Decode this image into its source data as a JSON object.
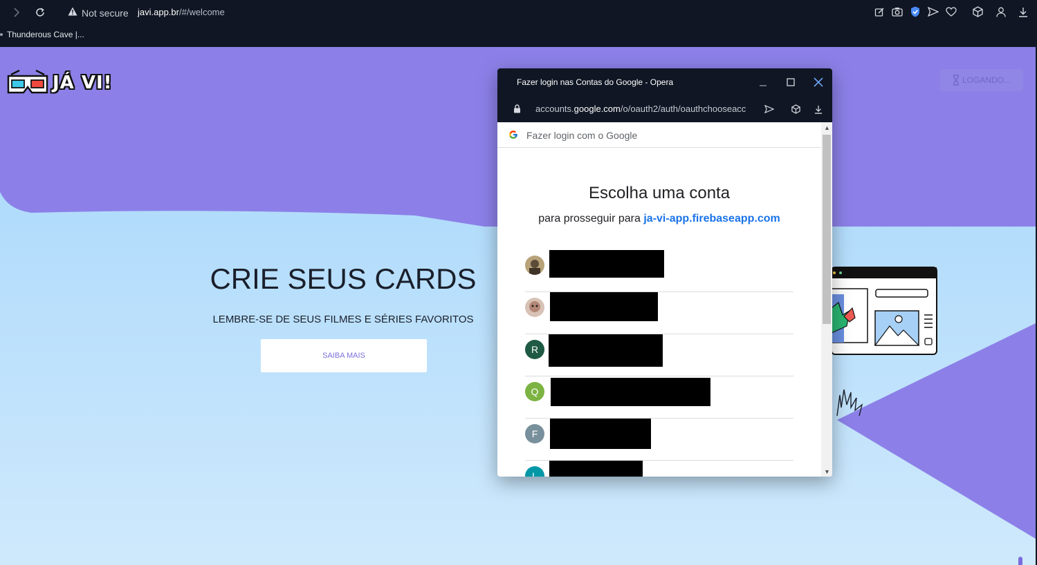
{
  "browser": {
    "security_label": "Not secure",
    "url_host": "javi.app.br",
    "url_path": "/#/welcome",
    "bookmark": "Thunderous Cave |..."
  },
  "page": {
    "logo_text": "JÁ VI!",
    "login_button": "LOGANDO...",
    "hero_title": "CRIE SEUS CARDS",
    "hero_subtitle": "LEMBRE-SE DE SEUS FILMES E SÉRIES FAVORITOS",
    "hero_button": "SAIBA MAIS"
  },
  "popup": {
    "window_title": "Fazer login nas Contas do Google - Opera",
    "address_prefix": "accounts.",
    "address_domain": "google.com",
    "address_path": "/o/oauth2/auth/oauthchooseacc",
    "header_label": "Fazer login com o Google",
    "heading": "Escolha uma conta",
    "continue_text": "para prosseguir para",
    "continue_link": "ja-vi-app.firebaseapp.com",
    "accounts": [
      {
        "initial": "",
        "color": "#8a7a60"
      },
      {
        "initial": "",
        "color": "#c7a89a"
      },
      {
        "initial": "R",
        "color": "#1e5a44"
      },
      {
        "initial": "Q",
        "color": "#7cb342"
      },
      {
        "initial": "F",
        "color": "#78909c"
      },
      {
        "initial": "L",
        "color": "#0097a7"
      }
    ]
  },
  "colors": {
    "chrome_bg": "#101623",
    "page_purple": "#8c80e8",
    "page_blue": "#a4d6fb",
    "google_blue": "#1a73e8"
  },
  "icons": [
    "forward-icon",
    "reload-icon",
    "warning-icon",
    "edit-icon",
    "camera-icon",
    "shield-icon",
    "send-icon",
    "heart-icon",
    "cube-icon",
    "user-icon",
    "download-icon",
    "lock-icon",
    "google-g-icon",
    "minimize-icon",
    "maximize-icon",
    "close-icon"
  ]
}
